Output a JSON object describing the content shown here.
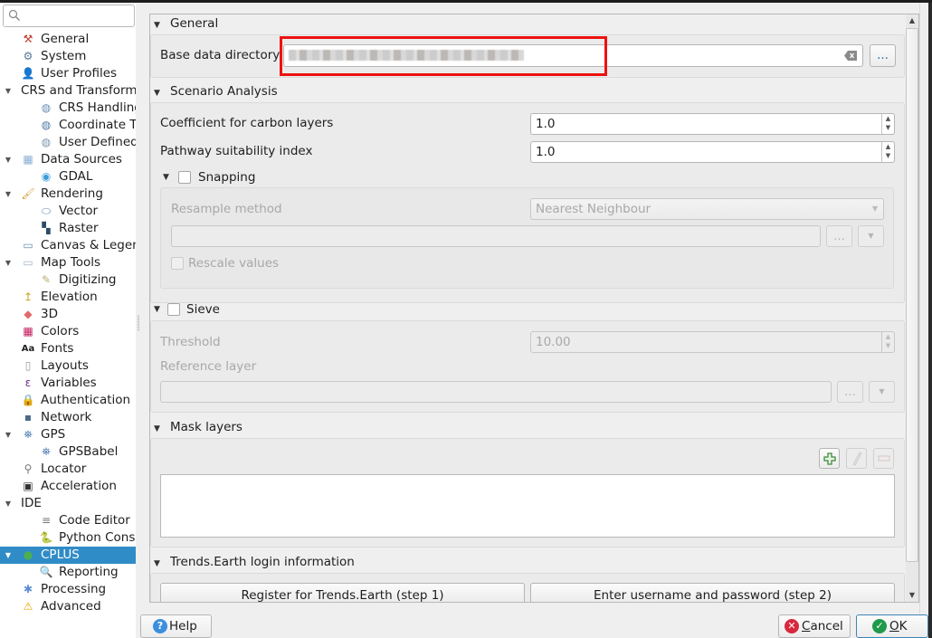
{
  "sidebar": {
    "search": {
      "placeholder": "",
      "value": ""
    },
    "items": [
      {
        "label": "General",
        "icon": "hammer-wrench-icon",
        "level": 1,
        "expanded": null
      },
      {
        "label": "System",
        "icon": "system-gear-icon",
        "level": 1,
        "expanded": null
      },
      {
        "label": "User Profiles",
        "icon": "user-profile-icon",
        "level": 1,
        "expanded": null
      },
      {
        "label": "CRS and Transformations",
        "icon": "",
        "level": 0,
        "expanded": true
      },
      {
        "label": "CRS Handling",
        "icon": "globe-icon",
        "level": 2,
        "expanded": null
      },
      {
        "label": "Coordinate Transforms",
        "icon": "globe-transform-icon",
        "level": 2,
        "expanded": null
      },
      {
        "label": "User Defined CRS",
        "icon": "globe-user-icon",
        "level": 2,
        "expanded": null
      },
      {
        "label": "Data Sources",
        "icon": "table-icon",
        "level": 1,
        "expanded": true
      },
      {
        "label": "GDAL",
        "icon": "gdal-globe-icon",
        "level": 2,
        "expanded": null
      },
      {
        "label": "Rendering",
        "icon": "paintbrush-icon",
        "level": 1,
        "expanded": true
      },
      {
        "label": "Vector",
        "icon": "vector-polygon-icon",
        "level": 2,
        "expanded": null
      },
      {
        "label": "Raster",
        "icon": "raster-checker-icon",
        "level": 2,
        "expanded": null
      },
      {
        "label": "Canvas & Legend",
        "icon": "canvas-icon",
        "level": 1,
        "expanded": null
      },
      {
        "label": "Map Tools",
        "icon": "map-tools-icon",
        "level": 1,
        "expanded": true
      },
      {
        "label": "Digitizing",
        "icon": "digitizing-icon",
        "level": 2,
        "expanded": null
      },
      {
        "label": "Elevation",
        "icon": "elevation-icon",
        "level": 1,
        "expanded": null
      },
      {
        "label": "3D",
        "icon": "cube-3d-icon",
        "level": 1,
        "expanded": null
      },
      {
        "label": "Colors",
        "icon": "color-palette-icon",
        "level": 1,
        "expanded": null
      },
      {
        "label": "Fonts",
        "icon": "fonts-aa-icon",
        "level": 1,
        "expanded": null
      },
      {
        "label": "Layouts",
        "icon": "layout-page-icon",
        "level": 1,
        "expanded": null
      },
      {
        "label": "Variables",
        "icon": "epsilon-variable-icon",
        "level": 1,
        "expanded": null
      },
      {
        "label": "Authentication",
        "icon": "padlock-icon",
        "level": 1,
        "expanded": null
      },
      {
        "label": "Network",
        "icon": "network-icon",
        "level": 1,
        "expanded": null
      },
      {
        "label": "GPS",
        "icon": "gps-satellite-icon",
        "level": 1,
        "expanded": true
      },
      {
        "label": "GPSBabel",
        "icon": "gps-satellite-icon",
        "level": 2,
        "expanded": null
      },
      {
        "label": "Locator",
        "icon": "magnifier-icon",
        "level": 1,
        "expanded": null
      },
      {
        "label": "Acceleration",
        "icon": "chip-icon",
        "level": 1,
        "expanded": null
      },
      {
        "label": "IDE",
        "icon": "",
        "level": 0,
        "expanded": true
      },
      {
        "label": "Code Editor",
        "icon": "code-editor-icon",
        "level": 2,
        "expanded": null
      },
      {
        "label": "Python Console",
        "icon": "python-icon",
        "level": 2,
        "expanded": null
      },
      {
        "label": "CPLUS",
        "icon": "cplus-logo-icon",
        "level": 0,
        "expanded": true,
        "selected": true
      },
      {
        "label": "Reporting",
        "icon": "report-magnifier-icon",
        "level": 2,
        "expanded": null
      },
      {
        "label": "Processing",
        "icon": "processing-gear-icon",
        "level": 1,
        "expanded": null
      },
      {
        "label": "Advanced",
        "icon": "warning-triangle-icon",
        "level": 1,
        "expanded": null
      }
    ]
  },
  "main": {
    "general": {
      "title": "General",
      "base_dir_label": "Base data directory",
      "base_dir_value": "",
      "browse_label": "..."
    },
    "scenario": {
      "title": "Scenario Analysis",
      "carbon_coef_label": "Coefficient for carbon layers",
      "carbon_coef_value": "1.0",
      "pathway_label": "Pathway suitability index",
      "pathway_value": "1.0",
      "snapping": {
        "title": "Snapping",
        "checked": false,
        "resample_label": "Resample method",
        "resample_value": "Nearest Neighbour",
        "layer_value": "",
        "browse_label": "...",
        "rescale_label": "Rescale values",
        "rescale_checked": false
      }
    },
    "sieve": {
      "title": "Sieve",
      "checked": false,
      "threshold_label": "Threshold",
      "threshold_value": "10.00",
      "reference_label": "Reference layer",
      "reference_value": "",
      "browse_label": "..."
    },
    "mask": {
      "title": "Mask layers"
    },
    "trends": {
      "title": "Trends.Earth login information",
      "register_label": "Register for Trends.Earth (step 1)",
      "enter_label": "Enter username and password (step 2)"
    }
  },
  "footer": {
    "help_label": "Help",
    "cancel_label": "Cancel",
    "ok_label": "OK"
  },
  "colors": {
    "selection": "#308cc6",
    "highlight_box": "#ee1111",
    "cancel_icon": "#d8283e",
    "ok_icon": "#1f9a4b",
    "help_icon": "#3b8fde"
  }
}
